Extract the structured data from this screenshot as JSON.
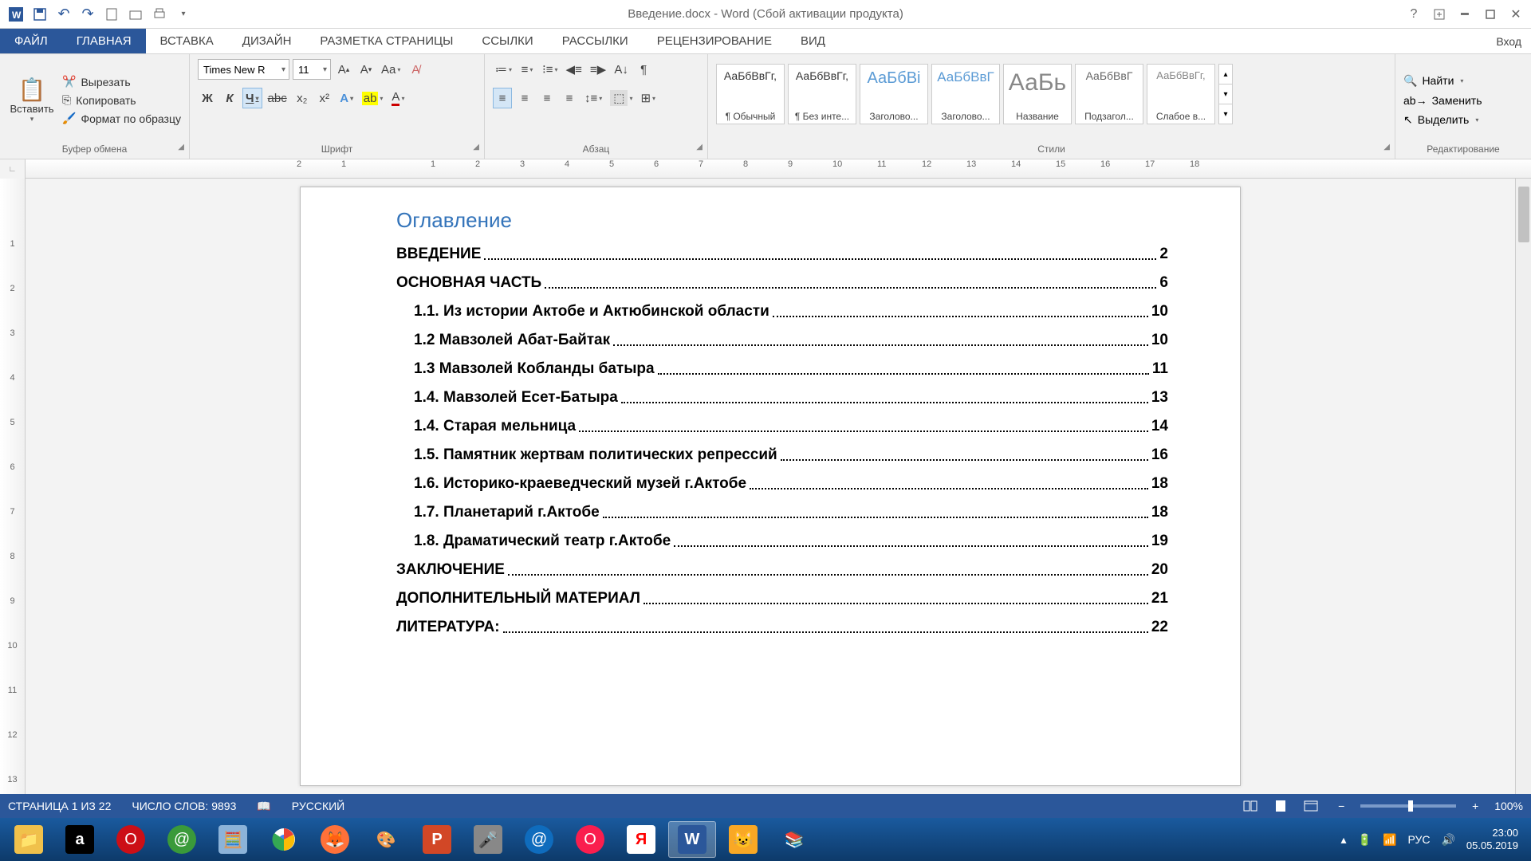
{
  "title": "Введение.docx - Word (Сбой активации продукта)",
  "qat": {
    "undo": "↶",
    "redo": "↷"
  },
  "tabs": {
    "file": "ФАЙЛ",
    "items": [
      "ГЛАВНАЯ",
      "ВСТАВКА",
      "ДИЗАЙН",
      "РАЗМЕТКА СТРАНИЦЫ",
      "ССЫЛКИ",
      "РАССЫЛКИ",
      "РЕЦЕНЗИРОВАНИЕ",
      "ВИД"
    ],
    "active": 0,
    "login": "Вход"
  },
  "ribbon": {
    "clipboard": {
      "paste": "Вставить",
      "cut": "Вырезать",
      "copy": "Копировать",
      "format_painter": "Формат по образцу",
      "group": "Буфер обмена"
    },
    "font": {
      "name": "Times New R",
      "size": "11",
      "group": "Шрифт",
      "bold": "Ж",
      "italic": "К",
      "underline": "Ч",
      "strike": "abc",
      "sub": "x₂",
      "sup": "x²"
    },
    "paragraph": {
      "group": "Абзац"
    },
    "styles": {
      "group": "Стили",
      "items": [
        {
          "sample": "АаБбВвГг,",
          "name": "¶ Обычный",
          "color": "#333",
          "fs": "14"
        },
        {
          "sample": "АаБбВвГг,",
          "name": "¶ Без инте...",
          "color": "#333",
          "fs": "14"
        },
        {
          "sample": "АаБбВі",
          "name": "Заголово...",
          "color": "#5b9bd5",
          "fs": "20"
        },
        {
          "sample": "АаБбВвГ",
          "name": "Заголово...",
          "color": "#5b9bd5",
          "fs": "17"
        },
        {
          "sample": "АаБь",
          "name": "Название",
          "color": "#888",
          "fs": "30"
        },
        {
          "sample": "АаБбВвГ",
          "name": "Подзагол...",
          "color": "#666",
          "fs": "14"
        },
        {
          "sample": "АаБбВвГг,",
          "name": "Слабое в...",
          "color": "#888",
          "fs": "13"
        }
      ]
    },
    "editing": {
      "find": "Найти",
      "replace": "Заменить",
      "select": "Выделить",
      "group": "Редактирование"
    }
  },
  "document": {
    "toc_title": "Оглавление",
    "entries": [
      {
        "text": "ВВЕДЕНИЕ",
        "page": "2",
        "level": 0
      },
      {
        "text": "ОСНОВНАЯ ЧАСТЬ",
        "page": "6",
        "level": 0
      },
      {
        "text": "1.1. Из истории Актобе и Актюбинской области",
        "page": "10",
        "level": 1
      },
      {
        "text": "1.2 Мавзолей Абат-Байтак",
        "page": "10",
        "level": 1
      },
      {
        "text": "1.3 Мавзолей Кобланды батыра",
        "page": "11",
        "level": 1
      },
      {
        "text": "1.4. Мавзолей Есет-Батыра",
        "page": "13",
        "level": 1
      },
      {
        "text": "1.4. Старая мельница",
        "page": "14",
        "level": 1
      },
      {
        "text": "1.5. Памятник жертвам политических репрессий",
        "page": "16",
        "level": 1
      },
      {
        "text": "1.6. Историко-краеведческий музей г.Актобе",
        "page": "18",
        "level": 1
      },
      {
        "text": "1.7. Планетарий г.Актобе",
        "page": "18",
        "level": 1
      },
      {
        "text": "1.8. Драматический театр г.Актобе",
        "page": "19",
        "level": 1
      },
      {
        "text": "ЗАКЛЮЧЕНИЕ",
        "page": "20",
        "level": 0
      },
      {
        "text": "ДОПОЛНИТЕЛЬНЫЙ МАТЕРИАЛ",
        "page": "21",
        "level": 0
      },
      {
        "text": "ЛИТЕРАТУРА:",
        "page": "22",
        "level": 0
      }
    ]
  },
  "status": {
    "page": "СТРАНИЦА 1 ИЗ 22",
    "words": "ЧИСЛО СЛОВ: 9893",
    "lang": "РУССКИЙ",
    "zoom": "100%"
  },
  "tray": {
    "lang": "РУС",
    "time": "23:00",
    "date": "05.05.2019"
  },
  "h_ruler": [
    "2",
    "1",
    "",
    "1",
    "2",
    "3",
    "4",
    "5",
    "6",
    "7",
    "8",
    "9",
    "10",
    "11",
    "12",
    "13",
    "14",
    "15",
    "16",
    "17",
    "18"
  ],
  "v_ruler": [
    "",
    "1",
    "2",
    "3",
    "4",
    "5",
    "6",
    "7",
    "8",
    "9",
    "10",
    "11",
    "12",
    "13"
  ]
}
